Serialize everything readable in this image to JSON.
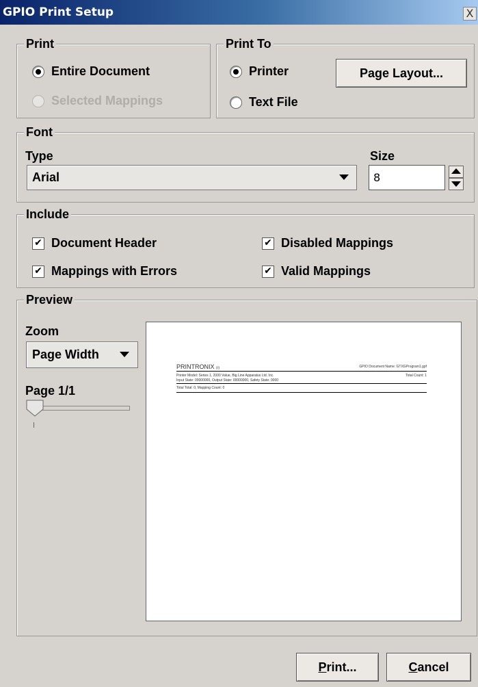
{
  "window": {
    "title": "GPIO Print Setup",
    "close_glyph": "X"
  },
  "print_group": {
    "legend": "Print",
    "options": [
      {
        "label": "Entire Document",
        "selected": true,
        "enabled": true
      },
      {
        "label": "Selected Mappings",
        "selected": false,
        "enabled": false
      }
    ]
  },
  "print_to_group": {
    "legend": "Print To",
    "options": [
      {
        "label": "Printer",
        "selected": true
      },
      {
        "label": "Text File",
        "selected": false
      }
    ],
    "page_layout_button": "Page Layout..."
  },
  "font_group": {
    "legend": "Font",
    "type_label": "Type",
    "type_value": "Arial",
    "size_label": "Size",
    "size_value": "8"
  },
  "include_group": {
    "legend": "Include",
    "options": [
      {
        "label": "Document Header",
        "checked": true
      },
      {
        "label": "Disabled Mappings",
        "checked": true
      },
      {
        "label": "Mappings with Errors",
        "checked": true
      },
      {
        "label": "Valid Mappings",
        "checked": true
      }
    ],
    "check_glyph": "✔"
  },
  "preview_group": {
    "legend": "Preview",
    "zoom_label": "Zoom",
    "zoom_value": "Page Width",
    "page_label": "Page 1/1",
    "slider_value_fraction": 0
  },
  "preview_doc": {
    "brand": "PRINTRONIX",
    "brand_mark": "(r)",
    "doc_name": "GPIO Document Name: GTXGProgram1.gpf",
    "line1": "Printer Model: Series 1, 2000 Value, Big Line Apparatus Ltd. Inc.",
    "line2": "Input State: 00000000, Output State: 00000000, Safety State: 0000",
    "total": "Total Count: 1",
    "line3": "Total Total: 0, Mapping Count: 0"
  },
  "buttons": {
    "print": {
      "mnemonic": "P",
      "rest": "rint..."
    },
    "cancel": {
      "mnemonic": "C",
      "rest": "ancel"
    }
  }
}
